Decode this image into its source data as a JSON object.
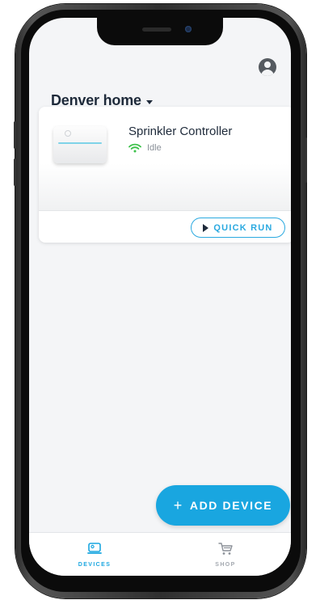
{
  "header": {
    "location_title": "Denver home"
  },
  "device_card": {
    "name": "Sprinkler Controller",
    "status": "Idle",
    "action_label": "QUICK RUN"
  },
  "fab": {
    "plus": "+",
    "label": "ADD DEVICE"
  },
  "tabbar": {
    "tabs": [
      {
        "label": "DEVICES",
        "icon": "devices-icon",
        "active": true
      },
      {
        "label": "SHOP",
        "icon": "cart-icon",
        "active": false
      }
    ]
  },
  "colors": {
    "accent": "#19a6e0",
    "title": "#1e2a3a",
    "status_wifi": "#3cc14a",
    "background": "#f4f5f7"
  }
}
